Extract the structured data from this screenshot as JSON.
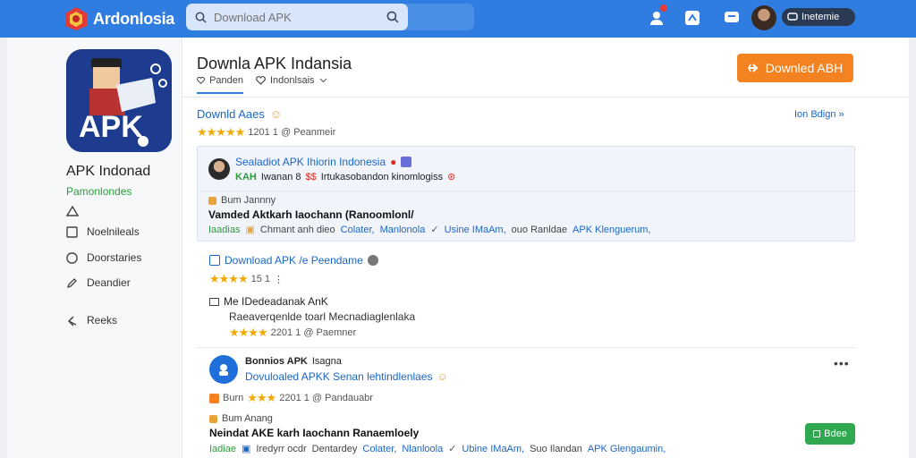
{
  "topbar": {
    "brand": "Ardonlosia",
    "search": {
      "value": "",
      "placeholder": "Download APK"
    },
    "pill_label": "Inetemie",
    "colors": {
      "bar": "#2f7de1",
      "accent": "#f58220",
      "success": "#2fa84f"
    }
  },
  "sidebar": {
    "app_name": "APK Indonad",
    "app_sub": "Pamonlondes",
    "items": [
      {
        "icon": "triangle-icon",
        "label": ""
      },
      {
        "icon": "square-icon",
        "label": "Noelnileals"
      },
      {
        "icon": "circle-icon",
        "label": "Doorstaries"
      },
      {
        "icon": "edit-icon",
        "label": "Deandier"
      },
      {
        "icon": "back-icon",
        "label": "Reeks"
      }
    ]
  },
  "header": {
    "title": "Downla APK Indansia",
    "download_button": "Downled ABH",
    "tabs": [
      {
        "icon": "heart-icon",
        "label": "Panden",
        "active": true
      },
      {
        "icon": "heart-icon",
        "label": "Indonlsais",
        "active": false
      }
    ]
  },
  "section": {
    "title": "Downld Aaes",
    "see_all": "Ion Bdign »",
    "rating": {
      "text": "1201 1 @ Peanmeir"
    }
  },
  "card": {
    "title": "Sealadiot APK Ihiorin Indonesia",
    "subtitle_prefix": "KAH",
    "subtitle_mid": "Iwanan 8",
    "subtitle_red": "$$",
    "subtitle_rest": "Irtukasobandon kinomlogiss",
    "meta": "Bum Jannny",
    "bold": "Vamded Aktkarh Iaochann (Ranoomlonl/",
    "tags": [
      {
        "text": "Iaadias",
        "tone": "g"
      },
      {
        "text": "Chmant anh dieo",
        "tone": "k"
      },
      {
        "text": "Colater,",
        "tone": "b"
      },
      {
        "text": "Manlonola",
        "tone": "b"
      },
      {
        "text": "Usine IMaAm,",
        "tone": "b"
      },
      {
        "text": "ouo Ranldae",
        "tone": "k"
      },
      {
        "text": "APK Klenguerum,",
        "tone": "b"
      }
    ]
  },
  "item2": {
    "title": "Download APK /e Peendame",
    "rating": "15 1",
    "line1": "Me IDedeadanak AnK",
    "line2": "Raeaverqenlde toarl Mecnadiaglenlaka",
    "rating2": "2201 1 @ Paemner"
  },
  "item3": {
    "title": "Bonnios APK",
    "title_tag": "Isagna",
    "subtitle": "Dovuloaled APKK Senan lehtindlenlaes",
    "meta_label": "Burn",
    "rating": "2201 1 @ Pandauabr",
    "meta": "Bum Anang",
    "bold": "Neindat AKE karh Iaochann Ranaemloely",
    "tags": [
      {
        "text": "Iadiae",
        "tone": "g"
      },
      {
        "text": "Iredyrr ocdr",
        "tone": "k"
      },
      {
        "text": "Dentardey",
        "tone": "k"
      },
      {
        "text": "Colater,",
        "tone": "b"
      },
      {
        "text": "Nlanloola",
        "tone": "b"
      },
      {
        "text": "Ubine IMaAm,",
        "tone": "b"
      },
      {
        "text": "Suo Ilandan",
        "tone": "k"
      },
      {
        "text": "APK Glengaumin,",
        "tone": "b"
      }
    ],
    "button": "Bdee"
  }
}
